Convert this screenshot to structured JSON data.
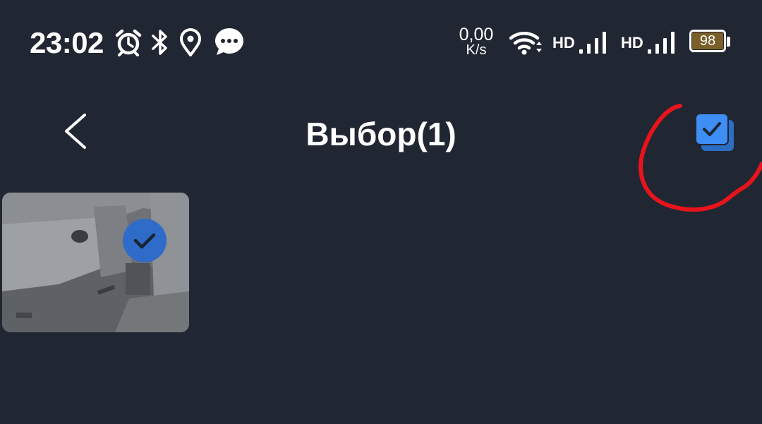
{
  "status_bar": {
    "time": "23:02",
    "icons": [
      "alarm-icon",
      "bluetooth-icon",
      "location-icon",
      "messages-icon"
    ],
    "net_speed_value": "0,00",
    "net_speed_unit": "K/s",
    "sim1_label": "HD",
    "sim2_label": "HD",
    "battery_level": "98"
  },
  "header": {
    "title": "Выбор(1)",
    "back_icon": "chevron-left-icon",
    "select_all_icon": "select-all-checkbox-icon"
  },
  "gallery": {
    "items": [
      {
        "kind": "camera-snapshot",
        "selected": true,
        "check_icon": "check-icon"
      }
    ]
  },
  "colors": {
    "background": "#212633",
    "accent": "#3d8ef5",
    "badge": "#2f6bc9",
    "annotation": "#e8141b",
    "battery_fill": "#7a5f2b"
  }
}
